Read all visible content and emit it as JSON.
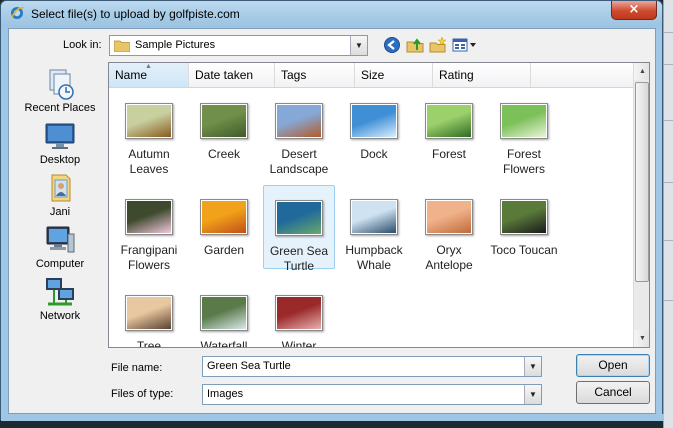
{
  "window": {
    "title": "Select file(s) to upload by golfpiste.com",
    "close_glyph": "×"
  },
  "look_in": {
    "label": "Look in:",
    "value": "Sample Pictures"
  },
  "toolbar": {
    "icons": [
      "back-icon",
      "up-folder-icon",
      "new-folder-icon",
      "views-menu-icon"
    ]
  },
  "places": [
    {
      "label": "Recent Places",
      "icon": "recent-places-icon"
    },
    {
      "label": "Desktop",
      "icon": "desktop-icon"
    },
    {
      "label": "Jani",
      "icon": "user-folder-icon"
    },
    {
      "label": "Computer",
      "icon": "computer-icon"
    },
    {
      "label": "Network",
      "icon": "network-icon"
    }
  ],
  "columns": [
    "Name",
    "Date taken",
    "Tags",
    "Size",
    "Rating"
  ],
  "files": [
    {
      "name": "Autumn Leaves",
      "c1": "#c8d0a0",
      "c2": "#8a5a1e"
    },
    {
      "name": "Creek",
      "c1": "#6f8f4a",
      "c2": "#3e5b2a"
    },
    {
      "name": "Desert Landscape",
      "c1": "#86a8d6",
      "c2": "#b45a2a"
    },
    {
      "name": "Dock",
      "c1": "#3f8ed6",
      "c2": "#d8eefc"
    },
    {
      "name": "Forest",
      "c1": "#9bd06a",
      "c2": "#2f6a25"
    },
    {
      "name": "Forest Flowers",
      "c1": "#7cc05a",
      "c2": "#e9f4d8"
    },
    {
      "name": "Frangipani Flowers",
      "c1": "#3e4a2e",
      "c2": "#f2c8dc"
    },
    {
      "name": "Garden",
      "c1": "#f2a21a",
      "c2": "#c0501a"
    },
    {
      "name": "Green Sea Turtle",
      "c1": "#1f6a9a",
      "c2": "#6aa86a"
    },
    {
      "name": "Humpback Whale",
      "c1": "#cfe2f2",
      "c2": "#2a4b6a"
    },
    {
      "name": "Oryx Antelope",
      "c1": "#f0b28a",
      "c2": "#c06a3a"
    },
    {
      "name": "Toco Toucan",
      "c1": "#5a7a3a",
      "c2": "#1a1a1a"
    },
    {
      "name": "Tree",
      "c1": "#e8c8a0",
      "c2": "#5a4030"
    },
    {
      "name": "Waterfall",
      "c1": "#5a7a4a",
      "c2": "#d8e8e8"
    },
    {
      "name": "Winter Leaves",
      "c1": "#9a2a2a",
      "c2": "#e8b0b0"
    }
  ],
  "selected_file": "Green Sea Turtle",
  "file_name": {
    "label": "File name:",
    "value": "Green Sea Turtle"
  },
  "files_of_type": {
    "label": "Files of type:",
    "value": "Images"
  },
  "buttons": {
    "open": "Open",
    "cancel": "Cancel"
  },
  "colors": {
    "titlebar": "#a6cbe6",
    "selection": "#e6f2fb",
    "selection_border": "#9dcfef",
    "close": "#c0381d"
  }
}
